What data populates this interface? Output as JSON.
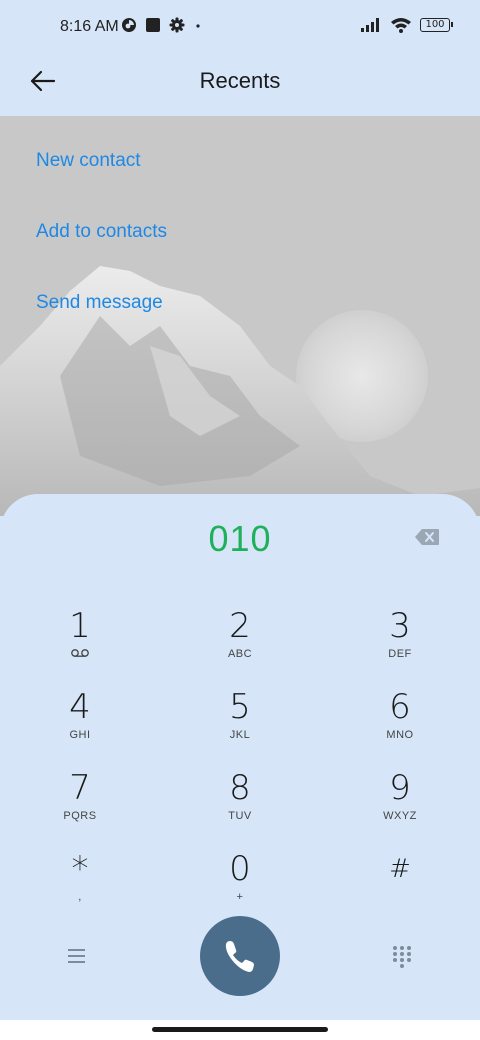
{
  "status_bar": {
    "time": "8:16 AM",
    "battery": "100",
    "icons_left": [
      "data-saver-icon",
      "square-app-icon",
      "gear-icon",
      "dot-icon"
    ],
    "icons_right": [
      "signal-icon",
      "wifi-icon",
      "battery-icon"
    ]
  },
  "header": {
    "title": "Recents",
    "back_icon": "back-arrow-icon"
  },
  "actions": {
    "new_contact": "New contact",
    "add_to_contacts": "Add to contacts",
    "send_message": "Send message"
  },
  "dialpad": {
    "number": "010",
    "number_color": "#1fb05a",
    "backspace_icon": "backspace-icon",
    "keys": [
      {
        "digit": "1",
        "letters": "",
        "sub_icon": "voicemail-icon"
      },
      {
        "digit": "2",
        "letters": "ABC"
      },
      {
        "digit": "3",
        "letters": "DEF"
      },
      {
        "digit": "4",
        "letters": "GHI"
      },
      {
        "digit": "5",
        "letters": "JKL"
      },
      {
        "digit": "6",
        "letters": "MNO"
      },
      {
        "digit": "7",
        "letters": "PQRS"
      },
      {
        "digit": "8",
        "letters": "TUV"
      },
      {
        "digit": "9",
        "letters": "WXYZ"
      },
      {
        "digit": "*",
        "letters": ","
      },
      {
        "digit": "0",
        "letters": "+"
      },
      {
        "digit": "#",
        "letters": ""
      }
    ],
    "menu_icon": "menu-icon",
    "call_icon": "phone-icon",
    "call_color": "#4a6d8c",
    "keypad_icon": "keypad-grid-icon"
  },
  "colors": {
    "accent": "#1e88e5",
    "background": "#d6e6f8"
  }
}
